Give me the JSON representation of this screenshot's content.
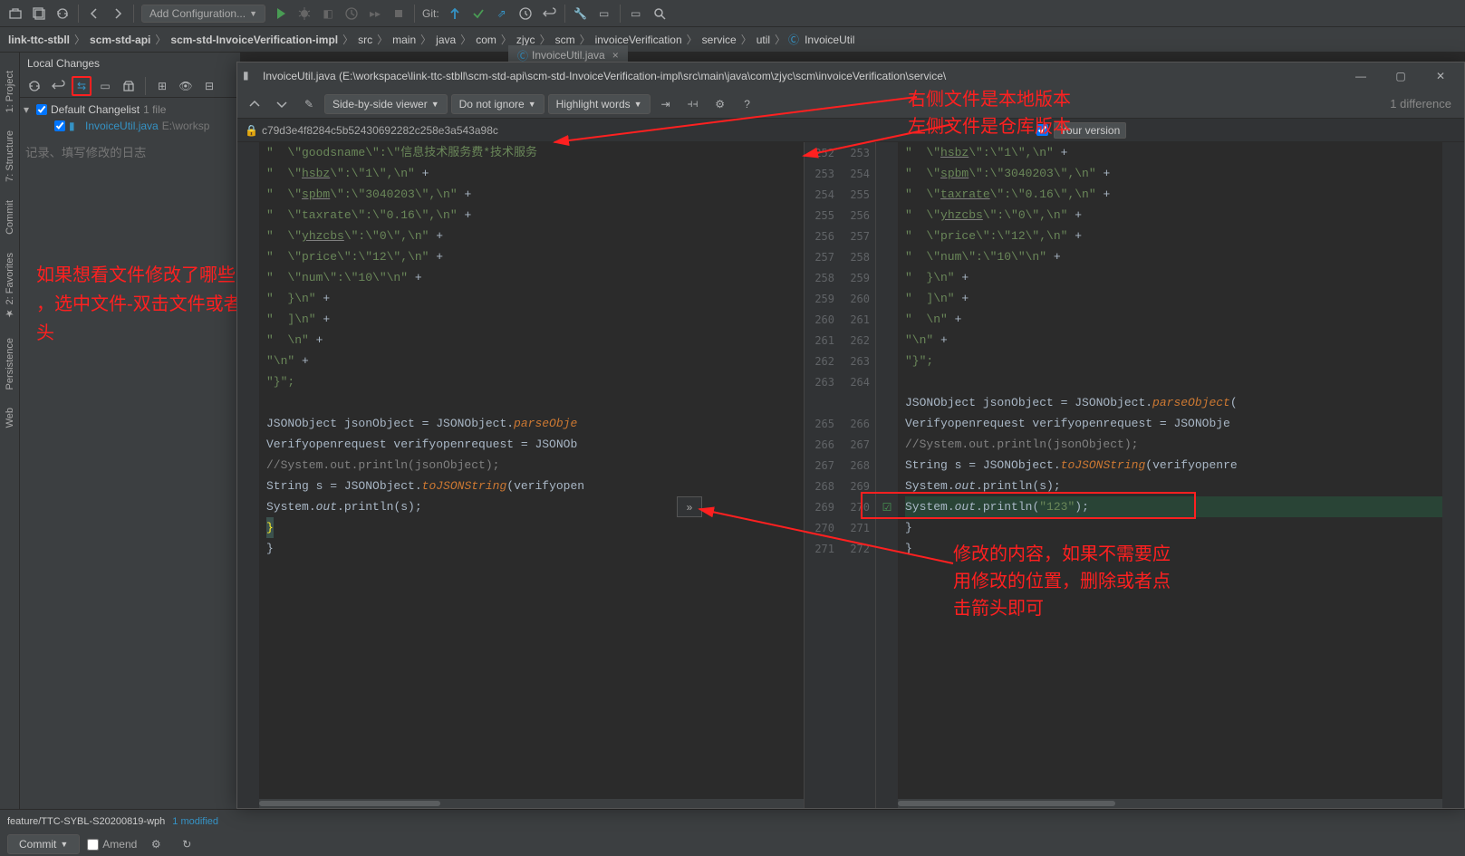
{
  "toolbar": {
    "run_config": "Add Configuration...",
    "git_label": "Git:"
  },
  "breadcrumbs": [
    "link-ttc-stbll",
    "scm-std-api",
    "scm-std-InvoiceVerification-impl",
    "src",
    "main",
    "java",
    "com",
    "zjyc",
    "scm",
    "invoiceVerification",
    "service",
    "util",
    "InvoiceUtil"
  ],
  "editor_tab": "InvoiceUtil.java",
  "vcs": {
    "header": "Local Changes",
    "changelist": "Default Changelist",
    "count": "1 file",
    "file": "InvoiceUtil.java",
    "file_path": "E:\\worksp",
    "commit_placeholder": "记录、填写修改的日志"
  },
  "diff": {
    "title": "InvoiceUtil.java (E:\\workspace\\link-ttc-stbll\\scm-std-api\\scm-std-InvoiceVerification-impl\\src\\main\\java\\com\\zjyc\\scm\\invoiceVerification\\service\\",
    "viewer_mode": "Side-by-side viewer",
    "ignore_mode": "Do not ignore",
    "highlight_mode": "Highlight words",
    "count": "1 difference",
    "left_hash": "c79d3e4f8284c5b52430692282c258e3a543a98c",
    "your_version": "Your version"
  },
  "annotations": {
    "top_right_1": "右侧文件是本地版本",
    "top_right_2": "左侧文件是仓库版本",
    "left_1": "如果想看文件修改了哪些内容",
    "left_2": "，选中文件-双击文件或者点击双箭头",
    "bottom_1": "修改的内容，如果不需要应",
    "bottom_2": "用修改的位置，删除或者点",
    "bottom_3": "击箭头即可"
  },
  "status": {
    "branch": "feature/TTC-SYBL-S20200819-wph",
    "modified": "1 modified",
    "commit": "Commit",
    "amend": "Amend"
  },
  "left_code": [
    {
      "t": "\"  \\\"goodsname\\\":\\\"信息技术服务费*技术服务",
      "plus": false,
      "cls": "str close"
    },
    {
      "t": "\"  \\\"hsbz\\\":\\\"1\\\",\\n\"",
      "plus": true,
      "cls": "str",
      "u": "hsbz"
    },
    {
      "t": "\"  \\\"spbm\\\":\\\"3040203\\\",\\n\"",
      "plus": true,
      "cls": "str",
      "u": "spbm"
    },
    {
      "t": "\"  \\\"taxrate\\\":\\\"0.16\\\",\\n\"",
      "plus": true,
      "cls": "str"
    },
    {
      "t": "\"  \\\"yhzcbs\\\":\\\"0\\\",\\n\"",
      "plus": true,
      "cls": "str",
      "u": "yhzcbs"
    },
    {
      "t": "\"  \\\"price\\\":\\\"12\\\",\\n\"",
      "plus": true,
      "cls": "str"
    },
    {
      "t": "\"  \\\"num\\\":\\\"10\\\"\\n\"",
      "plus": true,
      "cls": "str"
    },
    {
      "t": "\"  }\\n\"",
      "plus": true,
      "cls": "str"
    },
    {
      "t": "\"  ]\\n\"",
      "plus": true,
      "cls": "str"
    },
    {
      "t": "\"  \\n\"",
      "plus": true,
      "cls": "str"
    },
    {
      "t": "\"\\n\"",
      "plus": true,
      "cls": "str"
    },
    {
      "t": "\"}\";",
      "plus": false,
      "cls": "str"
    },
    {
      "t": "",
      "plus": false
    },
    {
      "t": "JSONObject jsonObject = JSONObject.parseObje",
      "plus": false,
      "cls": "code-j",
      "method": "parseObje"
    },
    {
      "t": "Verifyopenrequest verifyopenrequest = JSONOb",
      "plus": false,
      "cls": "code-j"
    },
    {
      "t": "//System.out.println(jsonObject);",
      "plus": false,
      "cls": "cmt"
    },
    {
      "t": "String s = JSONObject.toJSONString(verifyopen",
      "plus": false,
      "cls": "code-j",
      "method": "toJSONString"
    },
    {
      "t": "System.out.println(s);",
      "plus": false,
      "cls": "code-out"
    },
    {
      "t": "}",
      "plus": false,
      "brace": true
    },
    {
      "t": "}",
      "plus": false
    }
  ],
  "left_nums": [
    252,
    253,
    254,
    255,
    256,
    257,
    258,
    259,
    260,
    261,
    262,
    263,
    "",
    265,
    266,
    267,
    268,
    269,
    270,
    271
  ],
  "right_nums": [
    253,
    254,
    255,
    256,
    257,
    258,
    259,
    260,
    261,
    262,
    263,
    264,
    "",
    266,
    267,
    268,
    269,
    270,
    271,
    272,
    272
  ],
  "right_code": [
    {
      "t": "\"  \\\"hsbz\\\":\\\"1\\\",\\n\"",
      "plus": true,
      "cls": "str",
      "u": "hsbz"
    },
    {
      "t": "\"  \\\"spbm\\\":\\\"3040203\\\",\\n\"",
      "plus": true,
      "cls": "str",
      "u": "spbm"
    },
    {
      "t": "\"  \\\"taxrate\\\":\\\"0.16\\\",\\n\"",
      "plus": true,
      "cls": "str",
      "u": "taxrate"
    },
    {
      "t": "\"  \\\"yhzcbs\\\":\\\"0\\\",\\n\"",
      "plus": true,
      "cls": "str",
      "u": "yhzcbs"
    },
    {
      "t": "\"  \\\"price\\\":\\\"12\\\",\\n\"",
      "plus": true,
      "cls": "str"
    },
    {
      "t": "\"  \\\"num\\\":\\\"10\\\"\\n\"",
      "plus": true,
      "cls": "str"
    },
    {
      "t": "\"  }\\n\"",
      "plus": true,
      "cls": "str"
    },
    {
      "t": "\"  ]\\n\"",
      "plus": true,
      "cls": "str"
    },
    {
      "t": "\"  \\n\"",
      "plus": true,
      "cls": "str"
    },
    {
      "t": "\"\\n\"",
      "plus": true,
      "cls": "str"
    },
    {
      "t": "\"}\";",
      "plus": false,
      "cls": "str"
    },
    {
      "t": "",
      "plus": false
    },
    {
      "t": "JSONObject jsonObject = JSONObject.parseObject(",
      "plus": false,
      "cls": "code-j",
      "method": "parseObject"
    },
    {
      "t": "Verifyopenrequest verifyopenrequest = JSONObje",
      "plus": false,
      "cls": "code-j"
    },
    {
      "t": "//System.out.println(jsonObject);",
      "plus": false,
      "cls": "cmt"
    },
    {
      "t": "String s = JSONObject.toJSONString(verifyopenre",
      "plus": false,
      "cls": "code-j",
      "method": "toJSONString"
    },
    {
      "t": "System.out.println(s);",
      "plus": false,
      "cls": "code-out"
    },
    {
      "t": "System.out.println(\"123\");",
      "plus": false,
      "cls": "code-out",
      "added": true
    },
    {
      "t": "}",
      "plus": false
    },
    {
      "t": "}",
      "plus": false
    }
  ]
}
